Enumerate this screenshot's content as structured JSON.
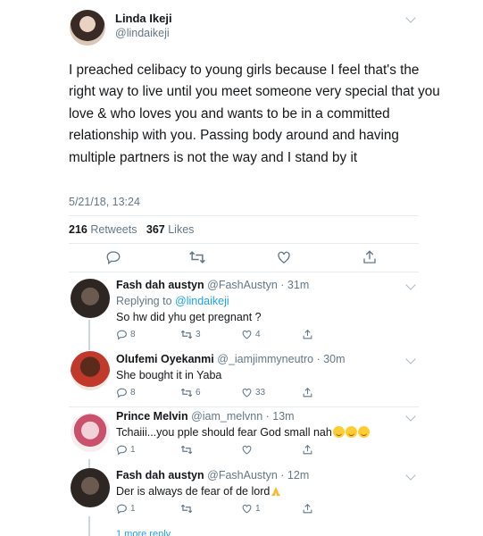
{
  "main_tweet": {
    "name": "Linda Ikeji",
    "handle": "@lindaikeji",
    "text": "I preached celibacy to young girls because I feel that's the right way to live until you meet someone very special that you love & who loves you and wants to be in a committed relationship with you. Passing body around and having multiple partners is not the way and I stand by it",
    "timestamp": "5/21/18, 13:24",
    "retweets_count": "216",
    "retweets_label": "Retweets",
    "likes_count": "367",
    "likes_label": "Likes"
  },
  "replies": [
    {
      "name": "Fash dah austyn",
      "meta": "@FashAustyn · 31m",
      "replying_label": "Replying to",
      "replying_to": "@lindaikeji",
      "text": "So hw did yhu get pregnant ?",
      "reply_count": "8",
      "retweet_count": "3",
      "like_count": "4"
    },
    {
      "name": "Olufemi Oyekanmi",
      "meta": "@_iamjimmyneutro · 30m",
      "text": "She bought it in Yaba",
      "reply_count": "8",
      "retweet_count": "6",
      "like_count": "33"
    },
    {
      "name": "Prince Melvin",
      "meta": "@iam_melvnn · 13m",
      "text": "Tchaiii...you pple should fear God small nah",
      "reply_count": "1",
      "retweet_count": "",
      "like_count": ""
    },
    {
      "name": "Fash dah austyn",
      "meta": "@FashAustyn · 12m",
      "text": "Der is always de fear of de lord",
      "reply_count": "1",
      "retweet_count": "",
      "like_count": "1"
    }
  ],
  "more_replies": "1 more reply",
  "colors": {
    "accent": "#1da1f2",
    "muted": "#657786",
    "text": "#14171a",
    "divider": "#e6ecf0"
  },
  "icons": [
    "reply-icon",
    "retweet-icon",
    "like-icon",
    "share-icon",
    "chevron-down-icon",
    "face-with-tears-of-joy-emoji",
    "folded-hands-emoji"
  ]
}
